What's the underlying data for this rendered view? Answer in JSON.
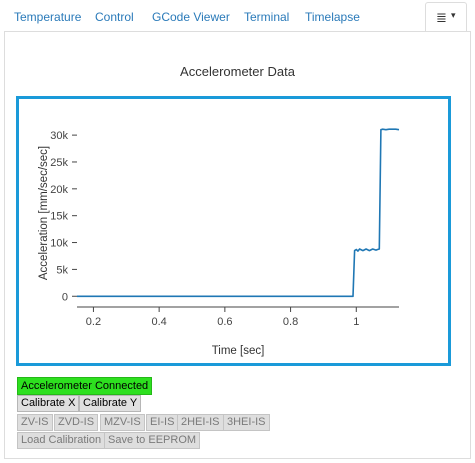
{
  "tabs": [
    {
      "label": "Temperature"
    },
    {
      "label": "Control"
    },
    {
      "label": "GCode Viewer"
    },
    {
      "label": "Terminal"
    },
    {
      "label": "Timelapse"
    }
  ],
  "tab_menu": {
    "icon": "hamburger-icon",
    "caret": "▾",
    "glyph": "≣"
  },
  "title": "Accelerometer Data",
  "chart_data": {
    "type": "line",
    "title": "",
    "xlabel": "Time [sec]",
    "ylabel": "Acceleration [mm/sec/sec]",
    "xlim": [
      0.15,
      1.13
    ],
    "ylim": [
      -2000,
      33000
    ],
    "xticks": [
      0.2,
      0.4,
      0.6,
      0.8,
      1
    ],
    "xtick_labels": [
      "0.2",
      "0.4",
      "0.6",
      "0.8",
      "1"
    ],
    "yticks": [
      0,
      5000,
      10000,
      15000,
      20000,
      25000,
      30000
    ],
    "ytick_labels": [
      "0",
      "5k",
      "10k",
      "15k",
      "20k",
      "25k",
      "30k"
    ],
    "series": [
      {
        "color": "#1f77b4",
        "x": [
          0.15,
          0.5,
          0.99,
          0.995,
          1.0,
          1.005,
          1.01,
          1.02,
          1.03,
          1.04,
          1.05,
          1.06,
          1.065,
          1.07,
          1.075,
          1.08,
          1.09,
          1.1,
          1.11,
          1.12,
          1.13
        ],
        "y": [
          0,
          0,
          0,
          8500,
          8700,
          8400,
          8800,
          8500,
          8800,
          8500,
          8800,
          8600,
          8700,
          8800,
          31000,
          31100,
          31000,
          31100,
          31100,
          31100,
          31000
        ]
      }
    ],
    "grid": false
  },
  "status": {
    "label": "Accelerometer Connected",
    "color": "#2de01f"
  },
  "buttons": {
    "calibrate_x": "Calibrate X",
    "calibrate_y": "Calibrate Y",
    "zv_is": "ZV-IS",
    "zvd_is": "ZVD-IS",
    "mzv_is": "MZV-IS",
    "ei_is": "EI-IS",
    "ei2h_is": "2HEI-IS",
    "ei3h_is": "3HEI-IS",
    "load_calibration": "Load Calibration",
    "save_eeprom": "Save to EEPROM"
  }
}
